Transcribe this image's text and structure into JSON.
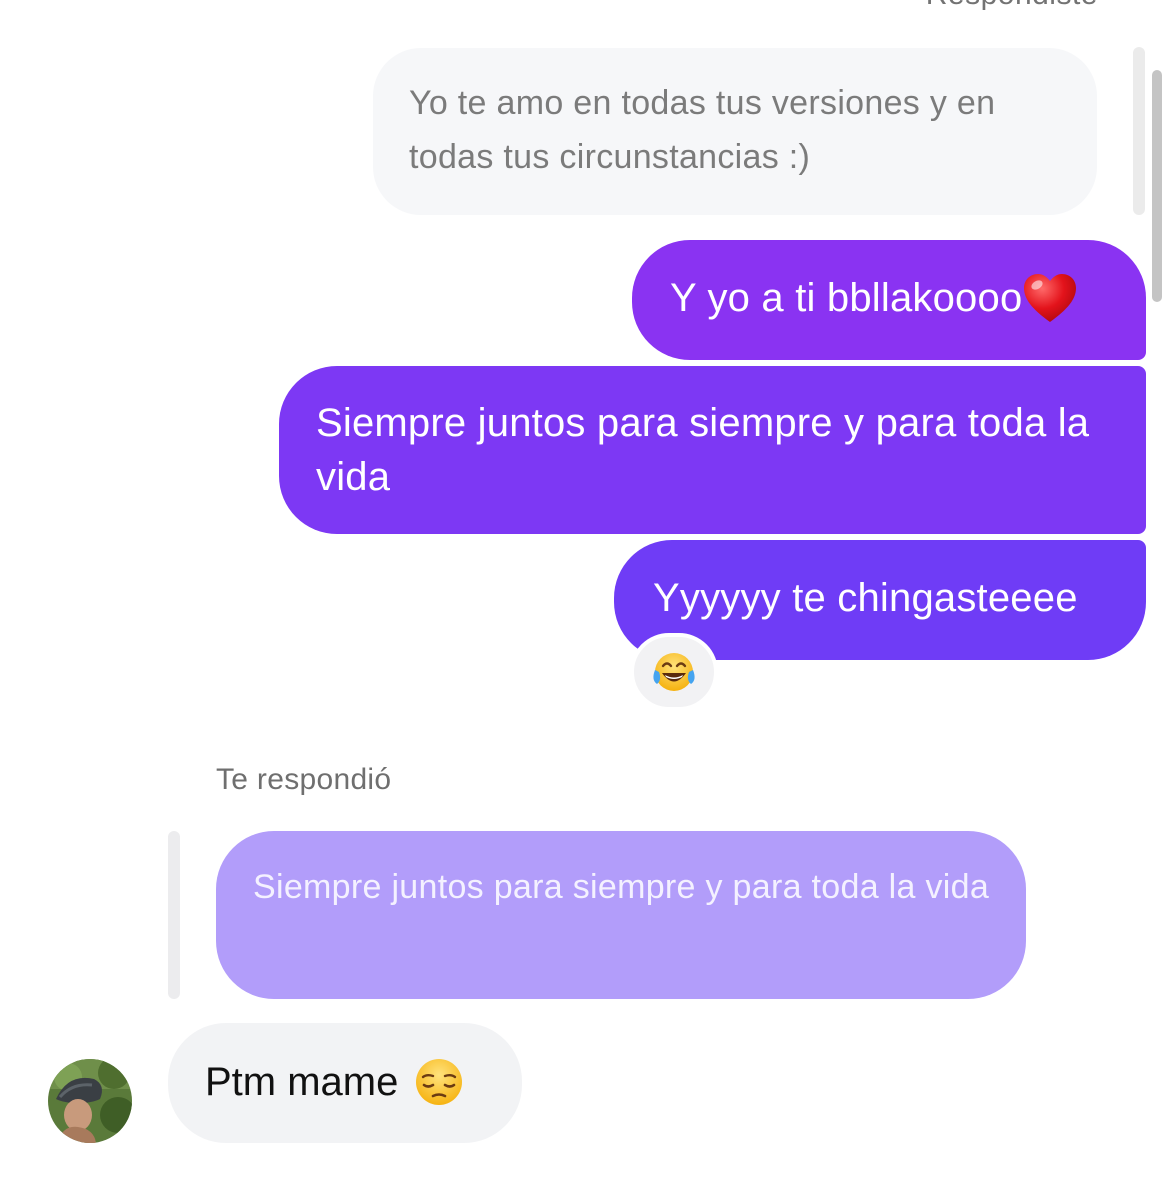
{
  "thread": {
    "top_label": "Respondiste",
    "my_reply_quote": "Yo te amo en todas tus versiones y en todas tus circunstancias :)",
    "outgoing": [
      {
        "text": "Y yo a ti bbllakoooo",
        "emoji": "red-heart"
      },
      {
        "text": "Siempre juntos para siempre y para toda la vida"
      },
      {
        "text": "Yyyyyy te chingasteeee",
        "reaction": "tears-of-joy"
      }
    ],
    "reply_label": "Te respondió",
    "their_reply_quote": "Siempre juntos para siempre y para toda la vida",
    "incoming": {
      "text": "Ptm mame",
      "emoji": "pensive-face"
    }
  },
  "colors": {
    "bubble_out_1": "#8a33f2",
    "bubble_out_2": "#7d38f4",
    "bubble_out_3": "#6f3cf6",
    "quote_purple": "#b29dfa",
    "bubble_in": "#f2f3f5",
    "quote_gray": "#f6f7f9"
  },
  "icons": [
    "red-heart-icon",
    "tears-of-joy-icon",
    "pensive-face-icon",
    "avatar"
  ]
}
